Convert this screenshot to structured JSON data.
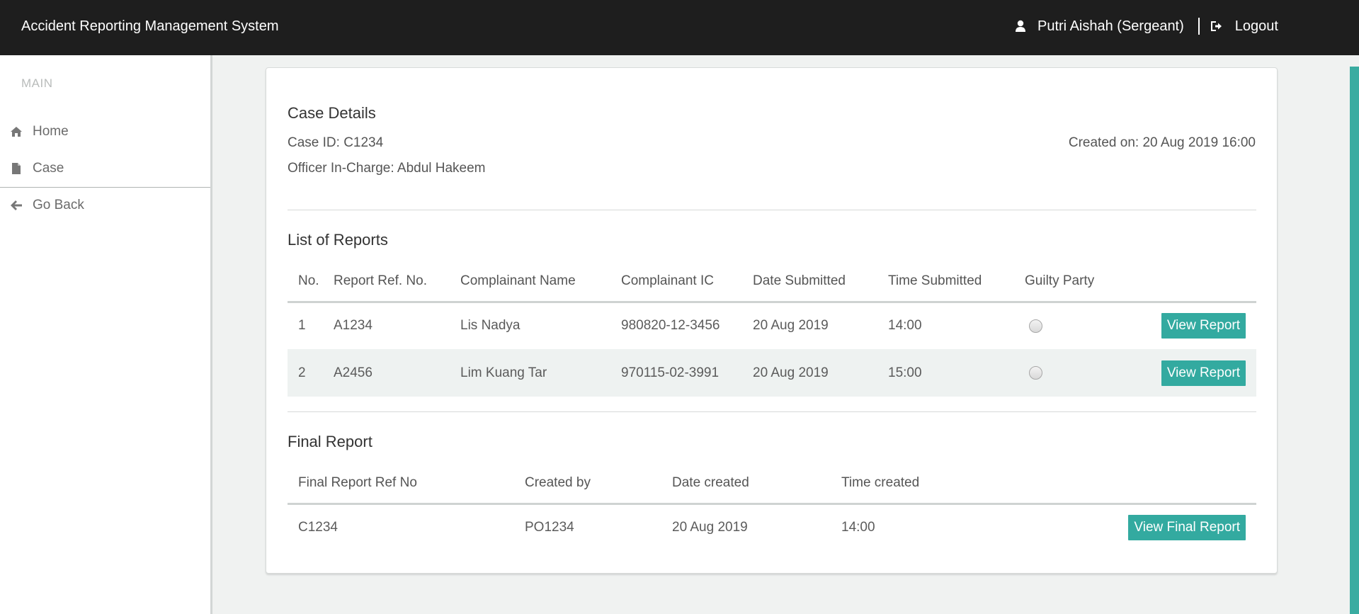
{
  "app": {
    "title": "Accident Reporting Management System",
    "user_label": "Putri Aishah (Sergeant)",
    "logout_label": "Logout"
  },
  "sidebar": {
    "section_label": "MAIN",
    "items": [
      {
        "label": "Home",
        "icon": "home-icon"
      },
      {
        "label": "Case",
        "icon": "file-icon"
      },
      {
        "label": "Go Back",
        "icon": "arrow-left-icon"
      }
    ]
  },
  "case": {
    "heading": "Case Details",
    "case_id_label": "Case ID:",
    "case_id": "C1234",
    "officer_label": "Officer In-Charge:",
    "officer": "Abdul Hakeem",
    "created_label": "Created on:",
    "created_on": "20 Aug 2019 16:00"
  },
  "reports": {
    "heading": "List of Reports",
    "columns": [
      "No.",
      "Report Ref. No.",
      "Complainant Name",
      "Complainant IC",
      "Date Submitted",
      "Time Submitted",
      "Guilty Party"
    ],
    "rows": [
      {
        "no": "1",
        "ref": "A1234",
        "name": "Lis Nadya",
        "ic": "980820-12-3456",
        "date": "20 Aug 2019",
        "time": "14:00",
        "guilty": false,
        "action": "View Report"
      },
      {
        "no": "2",
        "ref": "A2456",
        "name": "Lim Kuang Tar",
        "ic": "970115-02-3991",
        "date": "20 Aug 2019",
        "time": "15:00",
        "guilty": false,
        "action": "View Report"
      }
    ]
  },
  "final_report": {
    "heading": "Final Report",
    "columns": [
      "Final Report Ref No",
      "Created by",
      "Date created",
      "Time created"
    ],
    "rows": [
      {
        "ref": "C1234",
        "created_by": "PO1234",
        "date": "20 Aug 2019",
        "time": "14:00",
        "action": "View Final Report"
      }
    ]
  },
  "colors": {
    "topbar": "#1e1e1e",
    "accent": "#33aaa0",
    "background": "#f0f2f1"
  }
}
